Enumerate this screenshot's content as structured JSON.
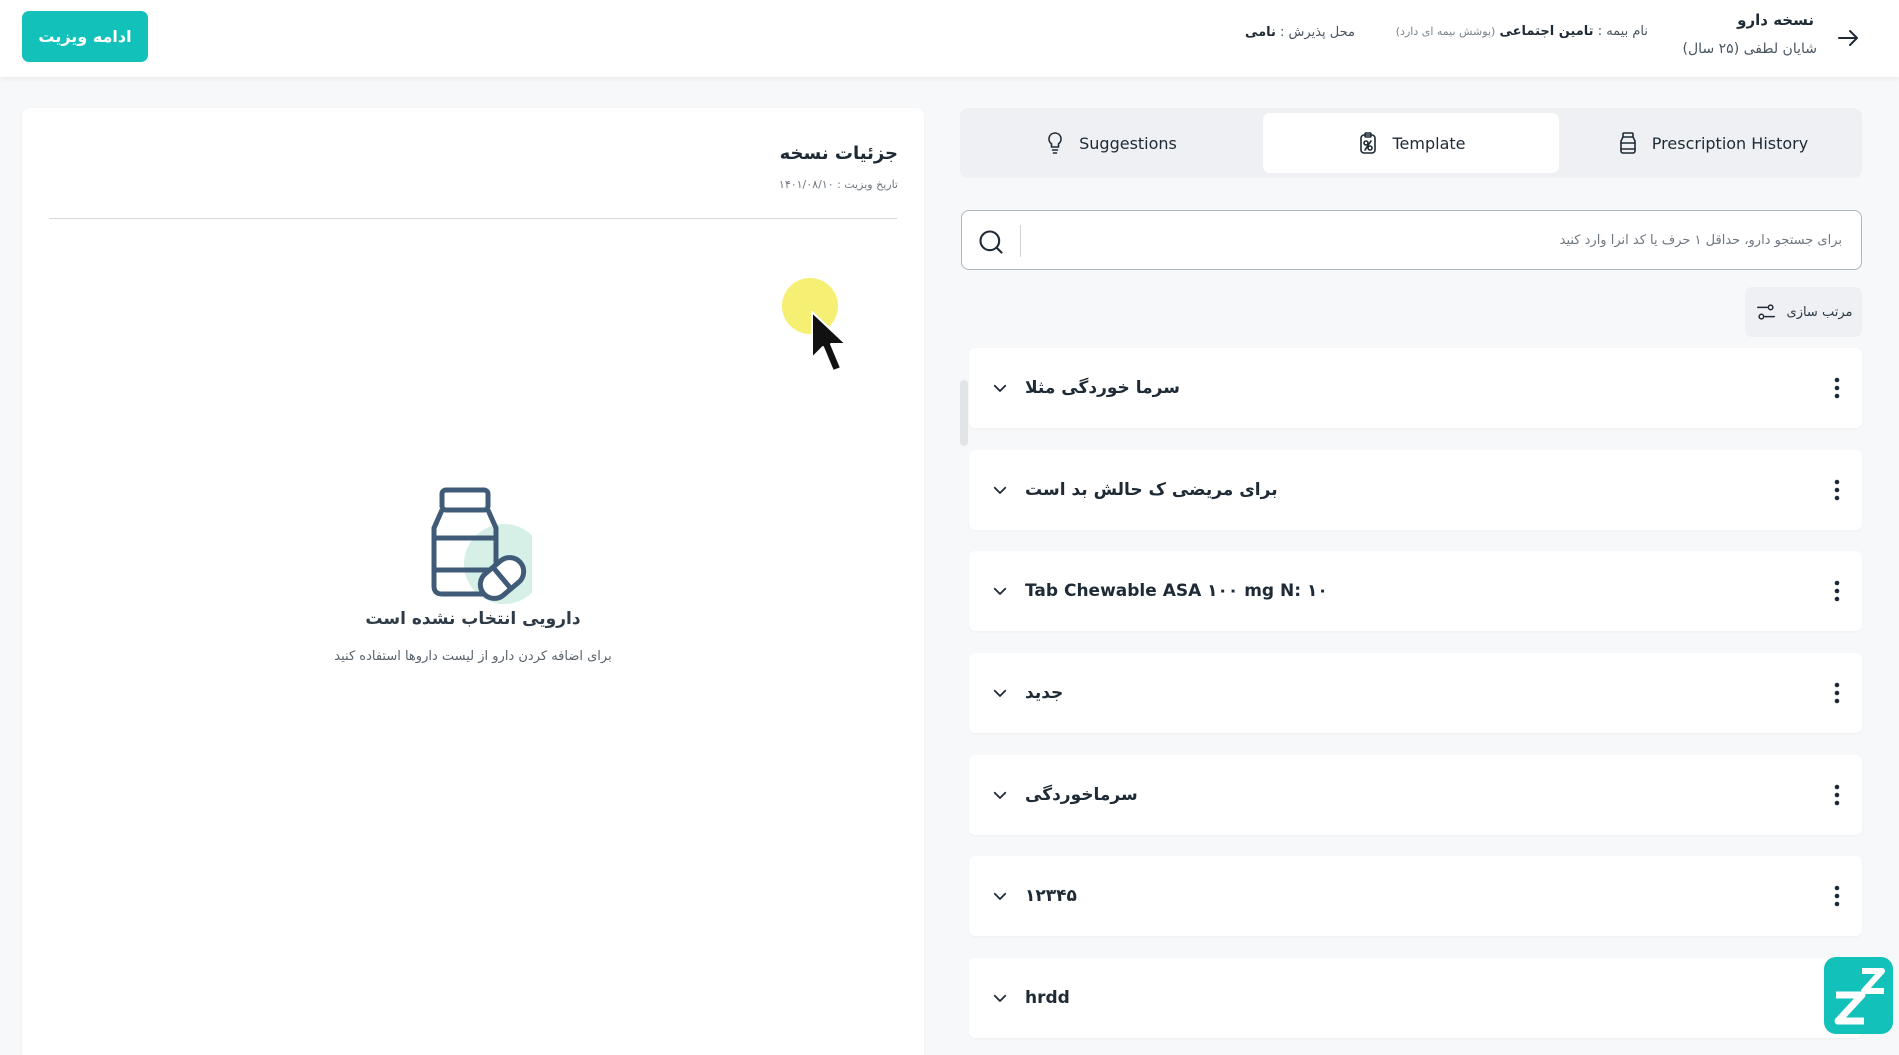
{
  "header": {
    "continue_label": "ادامه ویزیت",
    "page_title": "نسخه دارو",
    "patient": "شایان لطفی (۲۵ سال)",
    "insurance_prefix": "نام بیمه :",
    "insurance_name": "تامین اجتماعی",
    "insurance_note": "(پوشش بیمه ای دارد)",
    "reception_prefix": "محل پذیرش :",
    "reception_value": "نامی"
  },
  "details": {
    "title": "جزئیات نسخه",
    "visit_date": "تاریخ ویزیت : ۱۴۰۱/۰۸/۱۰",
    "empty_title": "دارویی انتخاب نشده است",
    "empty_subtitle": "برای اضافه کردن دارو از لیست داروها استفاده کنید"
  },
  "tabs": [
    {
      "label": "Suggestions",
      "icon": "lightbulb-icon",
      "active": false
    },
    {
      "label": "Template",
      "icon": "clipboard-icon",
      "active": true
    },
    {
      "label": "Prescription History",
      "icon": "pill-bottle-icon",
      "active": false
    }
  ],
  "search": {
    "placeholder": "برای جستجو دارو، حداقل ۱ حرف یا کد آنرا وارد کنید"
  },
  "sort": {
    "label": "مرتب سازی"
  },
  "templates": [
    {
      "label": "سرما خوردگی مثلا"
    },
    {
      "label": "برای مریضی ک حالش بد است"
    },
    {
      "label": "Tab Chewable ASA ۱۰۰ mg N: ۱۰"
    },
    {
      "label": "جدید"
    },
    {
      "label": "سرماخوردگی"
    },
    {
      "label": "۱۲۳۴۵"
    },
    {
      "label": "hrdd"
    }
  ],
  "colors": {
    "accent": "#12c1ba",
    "background": "#f7f8fa",
    "text": "#1e2a35"
  }
}
